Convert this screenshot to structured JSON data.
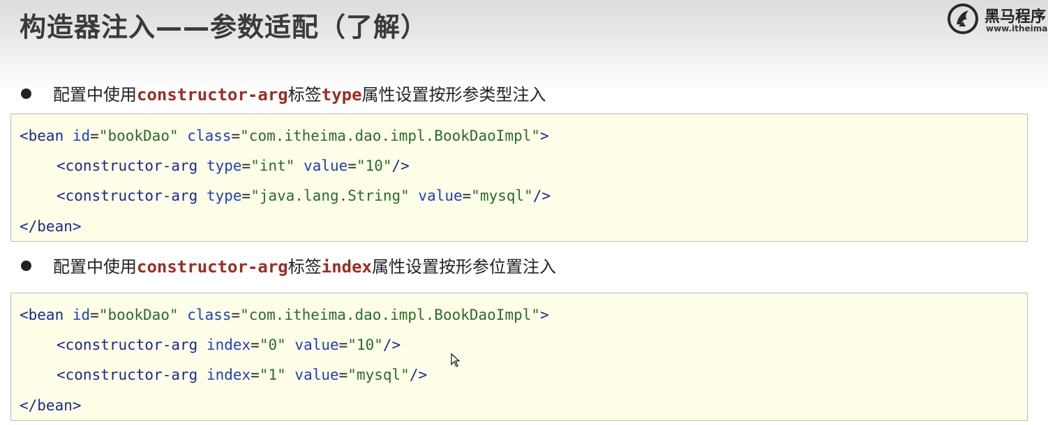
{
  "slide": {
    "title": "构造器注入——参数适配（了解）",
    "logo": {
      "name": "黑马程序",
      "url": "www.itheima.c"
    }
  },
  "section1": {
    "prefix": "配置中使用",
    "tag_kw": "constructor-arg",
    "mid": "标签",
    "attr_kw": "type",
    "suffix": "属性设置按形参类型注入"
  },
  "code1": {
    "line1": {
      "open": "<bean",
      "a1": "id",
      "v1": "\"bookDao\"",
      "a2": "class",
      "v2": "\"com.itheima.dao.impl.BookDaoImpl\"",
      "close": ">"
    },
    "line2": {
      "open": "<constructor-arg",
      "a1": "type",
      "v1": "\"int\"",
      "a2": "value",
      "v2": "\"10\"",
      "close": "/>"
    },
    "line3": {
      "open": "<constructor-arg",
      "a1": "type",
      "v1": "\"java.lang.String\"",
      "a2": "value",
      "v2": "\"mysql\"",
      "close": "/>"
    },
    "line4": {
      "open": "</bean>"
    }
  },
  "section2": {
    "prefix": "配置中使用",
    "tag_kw": "constructor-arg",
    "mid": "标签",
    "attr_kw": "index",
    "suffix": "属性设置按形参位置注入"
  },
  "code2": {
    "line1": {
      "open": "<bean",
      "a1": "id",
      "v1": "\"bookDao\"",
      "a2": "class",
      "v2": "\"com.itheima.dao.impl.BookDaoImpl\"",
      "close": ">"
    },
    "line2": {
      "open": "<constructor-arg",
      "a1": "index",
      "v1": "\"0\"",
      "a2": "value",
      "v2": "\"10\"",
      "close": "/>"
    },
    "line3": {
      "open": "<constructor-arg",
      "a1": "index",
      "v1": "\"1\"",
      "a2": "value",
      "v2": "\"mysql\"",
      "close": "/>"
    },
    "line4": {
      "open": "</bean>"
    }
  },
  "colors": {
    "code_bg": "#fdfde8",
    "keyword": "#9b2d23",
    "tag": "#1a2a8c",
    "attribute": "#1f3fb5",
    "value": "#2a6b2a"
  },
  "icons": [
    "itheima-logo-icon",
    "bullet-icon",
    "mouse-cursor-icon"
  ]
}
